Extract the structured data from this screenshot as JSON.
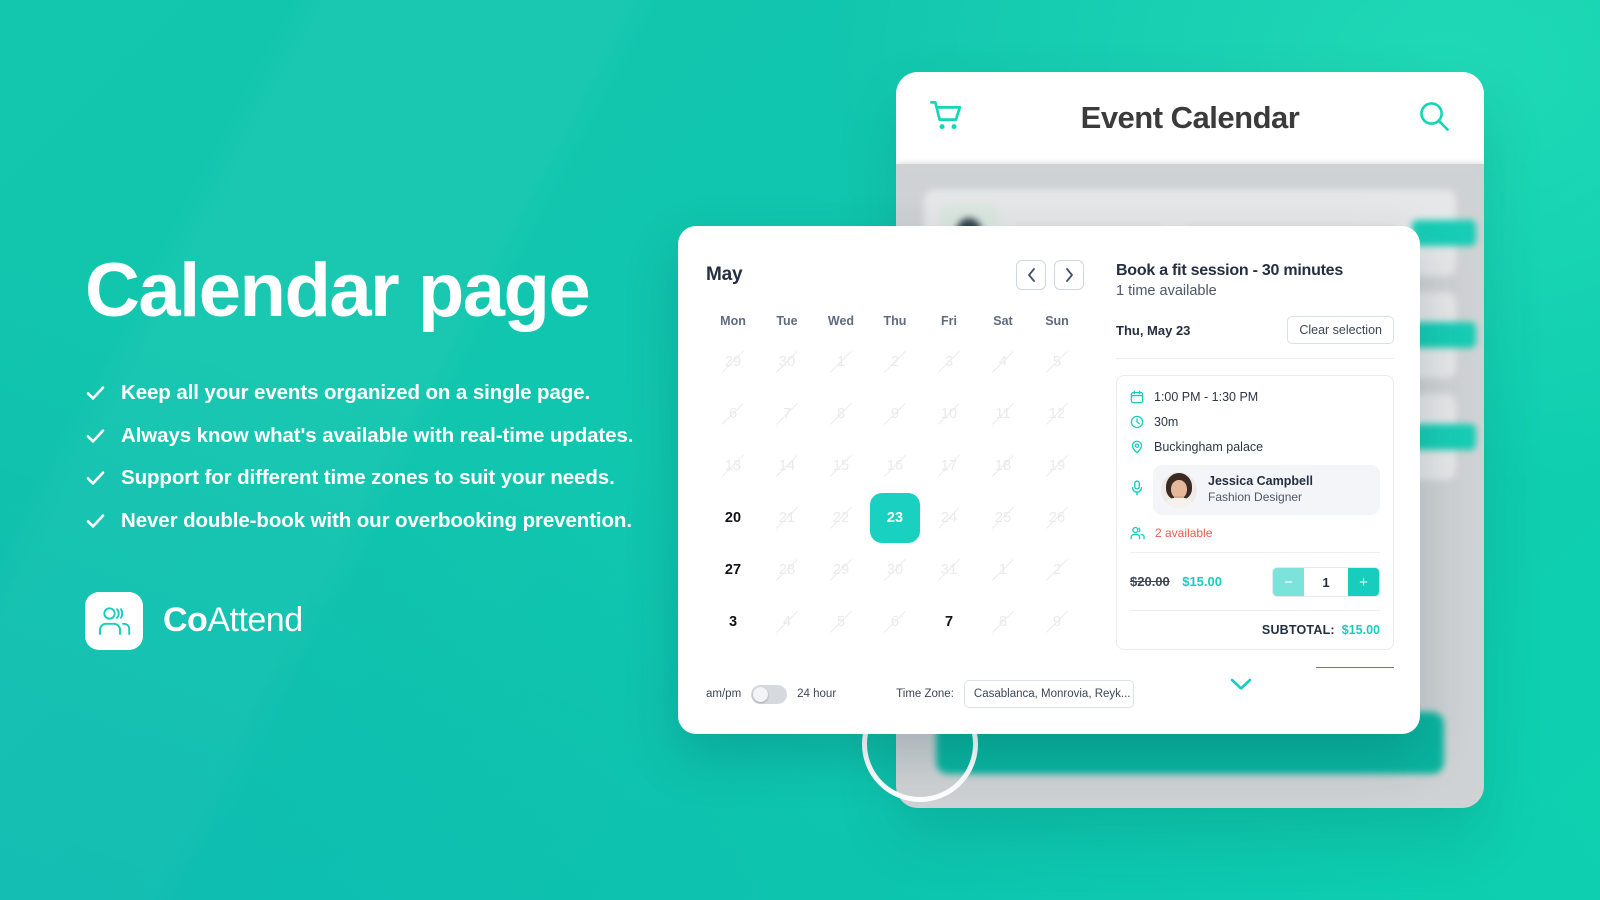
{
  "theme": {
    "accent": "#17cdbd",
    "accent_bright": "#1ad0c0",
    "bg_teal": "#11c3ae",
    "danger": "#f0554f",
    "ink": "#242f41"
  },
  "left_panel": {
    "headline": "Calendar page",
    "bullets": [
      "Keep all your events organized on a single page.",
      "Always know what's available with real-time updates.",
      "Support for different time zones to suit your needs.",
      "Never double-book with our overbooking prevention."
    ],
    "logo": {
      "icon": "people-icon",
      "name_bold": "Co",
      "name_light": "Attend"
    }
  },
  "tablet": {
    "topbar": {
      "cart_icon": "shopping-cart-icon",
      "title": "Event Calendar",
      "search_icon": "search-icon"
    }
  },
  "calendar": {
    "month": "May",
    "prev_label": "‹",
    "next_label": "›",
    "day_headers": [
      "Mon",
      "Tue",
      "Wed",
      "Thu",
      "Fri",
      "Sat",
      "Sun"
    ],
    "weeks": [
      [
        {
          "n": "29",
          "state": "disabled"
        },
        {
          "n": "30",
          "state": "disabled"
        },
        {
          "n": "1",
          "state": "disabled"
        },
        {
          "n": "2",
          "state": "disabled"
        },
        {
          "n": "3",
          "state": "disabled"
        },
        {
          "n": "4",
          "state": "disabled"
        },
        {
          "n": "5",
          "state": "disabled"
        }
      ],
      [
        {
          "n": "6",
          "state": "disabled"
        },
        {
          "n": "7",
          "state": "disabled"
        },
        {
          "n": "8",
          "state": "disabled"
        },
        {
          "n": "9",
          "state": "disabled"
        },
        {
          "n": "10",
          "state": "disabled"
        },
        {
          "n": "11",
          "state": "disabled"
        },
        {
          "n": "12",
          "state": "disabled"
        }
      ],
      [
        {
          "n": "13",
          "state": "disabled"
        },
        {
          "n": "14",
          "state": "disabled"
        },
        {
          "n": "15",
          "state": "disabled"
        },
        {
          "n": "16",
          "state": "disabled"
        },
        {
          "n": "17",
          "state": "disabled"
        },
        {
          "n": "18",
          "state": "disabled"
        },
        {
          "n": "19",
          "state": "disabled"
        }
      ],
      [
        {
          "n": "20",
          "state": "available"
        },
        {
          "n": "21",
          "state": "disabled"
        },
        {
          "n": "22",
          "state": "disabled"
        },
        {
          "n": "23",
          "state": "selected"
        },
        {
          "n": "24",
          "state": "disabled"
        },
        {
          "n": "25",
          "state": "disabled"
        },
        {
          "n": "26",
          "state": "disabled"
        }
      ],
      [
        {
          "n": "27",
          "state": "available"
        },
        {
          "n": "28",
          "state": "disabled"
        },
        {
          "n": "29",
          "state": "disabled"
        },
        {
          "n": "30",
          "state": "disabled"
        },
        {
          "n": "31",
          "state": "disabled"
        },
        {
          "n": "1",
          "state": "disabled"
        },
        {
          "n": "2",
          "state": "disabled"
        }
      ],
      [
        {
          "n": "3",
          "state": "available"
        },
        {
          "n": "4",
          "state": "disabled"
        },
        {
          "n": "5",
          "state": "disabled"
        },
        {
          "n": "6",
          "state": "disabled"
        },
        {
          "n": "7",
          "state": "available"
        },
        {
          "n": "8",
          "state": "disabled"
        },
        {
          "n": "9",
          "state": "disabled"
        }
      ]
    ],
    "footer": {
      "ampm_label": "am/pm",
      "hour24_label": "24 hour",
      "toggle_state": "am/pm",
      "timezone_label": "Time Zone:",
      "timezone_value": "Casablanca, Monrovia, Reyk...",
      "caret_icon": "chevron-down-icon"
    }
  },
  "booking": {
    "title": "Book a fit session - 30 minutes",
    "subtitle": "1 time available",
    "selected_date": "Thu, May 23",
    "clear_label": "Clear selection",
    "slot": {
      "time_icon": "calendar-icon",
      "time": "1:00 PM - 1:30 PM",
      "duration_icon": "clock-icon",
      "duration": "30m",
      "location_icon": "location-pin-icon",
      "location": "Buckingham palace",
      "staff_icon": "microphone-icon",
      "staff_name": "Jessica Campbell",
      "staff_role": "Fashion Designer",
      "availability_icon": "people-icon",
      "availability": "2 available",
      "price_old": "$20.00",
      "price_new": "$15.00",
      "qty_minus": "−",
      "qty_value": "1",
      "qty_plus": "+",
      "subtotal_label": "SUBTOTAL:",
      "subtotal_value": "$15.00",
      "expand_icon": "chevron-down-icon"
    }
  }
}
